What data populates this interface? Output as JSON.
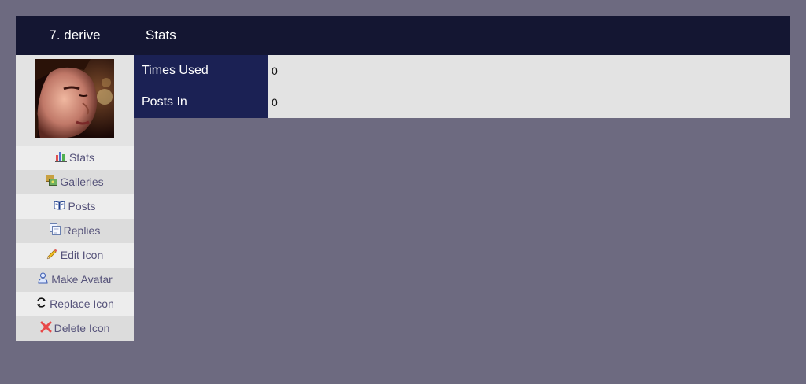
{
  "header": {
    "icon_title": "7. derive",
    "section_title": "Stats"
  },
  "sidebar": {
    "avatar_alt": "derive",
    "items": [
      {
        "label": "Stats",
        "icon": "bar-chart-icon"
      },
      {
        "label": "Galleries",
        "icon": "galleries-icon"
      },
      {
        "label": "Posts",
        "icon": "book-icon"
      },
      {
        "label": "Replies",
        "icon": "replies-icon"
      },
      {
        "label": "Edit Icon",
        "icon": "pencil-icon"
      },
      {
        "label": "Make Avatar",
        "icon": "user-icon"
      },
      {
        "label": "Replace Icon",
        "icon": "refresh-icon"
      },
      {
        "label": "Delete Icon",
        "icon": "delete-x-icon"
      }
    ]
  },
  "stats": {
    "rows": [
      {
        "label": "Times Used",
        "value": "0"
      },
      {
        "label": "Posts In",
        "value": "0"
      }
    ]
  },
  "colors": {
    "page_background": "#6d6a80",
    "header_background": "#141632",
    "label_cell_background": "#1b2154",
    "sidebar_background": "#e3e3e3",
    "menu_text": "#56537a",
    "delete_red": "#e84848"
  }
}
